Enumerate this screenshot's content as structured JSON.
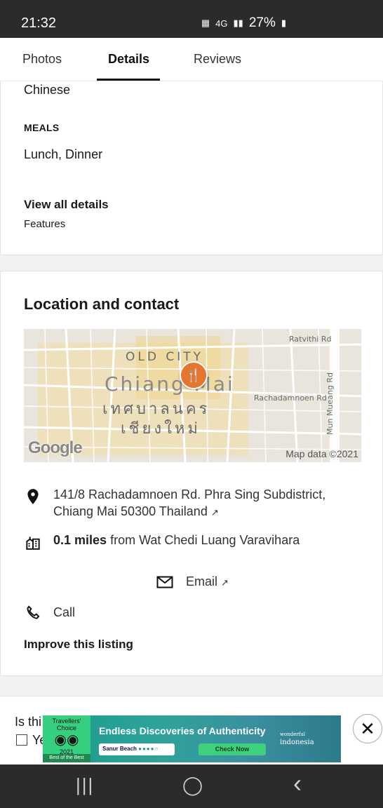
{
  "status": {
    "time": "21:32",
    "network": "4G",
    "battery": "27%"
  },
  "tabs": [
    "Photos",
    "Details",
    "Reviews"
  ],
  "details": {
    "cuisine": "Chinese",
    "meals_heading": "MEALS",
    "meals_value": "Lunch, Dinner",
    "view_all": "View all details",
    "features": "Features"
  },
  "location": {
    "title": "Location and contact",
    "map": {
      "labels": {
        "old_city": "OLD CITY",
        "city_en": "Chiang Mai",
        "city_th1": "เทศบาลนคร",
        "city_th2": "เชียงใหม่",
        "rd1": "Ratvithi Rd",
        "rd2": "Rachadamnoen Rd",
        "rd3": "Mun Mueang Rd"
      },
      "logo": "Google",
      "attribution": "Map data ©2021"
    },
    "address": "141/8 Rachadamnoen Rd. Phra Sing Subdistrict, Chiang Mai 50300 Thailand",
    "distance_value": "0.1 miles",
    "distance_text": "from Wat Chedi Luang Varavihara",
    "email_label": "Email",
    "call_label": "Call",
    "improve": "Improve this listing"
  },
  "question": {
    "text": "Is thi",
    "option": "Ye"
  },
  "ad": {
    "badge_top": "Travellers' Choice",
    "badge_year": "2021",
    "badge_bottom": "Best of the Best",
    "headline": "Endless Discoveries of Authenticity",
    "pill1": "Sanur Beach",
    "pill2": "Check Now",
    "brand_small": "wonderful",
    "brand": "indonesia",
    "close": "✕"
  },
  "colors": {
    "pin": "#e4762f",
    "ad_green": "#35d07f"
  },
  "nav": {
    "recent": "|||",
    "home": "◯",
    "back": "‹"
  }
}
